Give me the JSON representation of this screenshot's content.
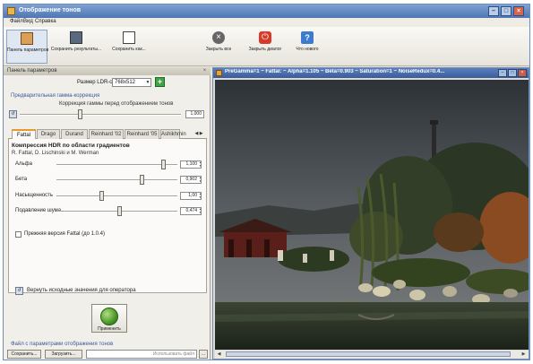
{
  "window": {
    "title": "Отображение тонов"
  },
  "menu": {
    "file": "Файл",
    "view": "Вид",
    "help": "Справка"
  },
  "toolbar": {
    "panel": "Панель параметров",
    "save_processed": "Сохранить результаты...",
    "save_as": "Сохранить как...",
    "close_all": "Закрыть все",
    "close_dialog": "Закрыть диалог",
    "whats_new": "Что нового"
  },
  "params_panel": {
    "title": "Панель параметров",
    "ldr_size_label": "Размер LDR-снимка:",
    "ldr_size_value": "768x512",
    "gamma_section": "Предварительная гамма-коррекция",
    "gamma_label": "Коррекция гаммы перед отображением тонов",
    "gamma_value": "1,000",
    "gamma_level": 0.37
  },
  "tabs": [
    "Fattal",
    "Drago",
    "Durand",
    "Reinhard '02",
    "Reinhard '05",
    "Ashikhmin"
  ],
  "active_tab": 0,
  "operator": {
    "title": "Компрессия HDR по области градиентов",
    "authors": "R. Fattal, D. Lischinski и M. Werman",
    "params": [
      {
        "label": "Альфа",
        "value": "1,100",
        "level": 0.88
      },
      {
        "label": "Бета",
        "value": "0,902",
        "level": 0.7
      },
      {
        "label": "Насыщенность",
        "value": "1,00",
        "level": 0.37
      },
      {
        "label": "Подавление шума",
        "value": "0,474",
        "level": 0.52
      }
    ],
    "old_fattal": "Прежняя версия Fattal (до 1.0.4)",
    "reset": "Вернуть исходные значения для оператора",
    "apply": "Применить"
  },
  "tm_params": {
    "section": "Файл с параметрами отображения тонов",
    "save": "Сохранить...",
    "load": "Загрузить...",
    "file_placeholder": "Использовать файл"
  },
  "image_window": {
    "title": "PreGamma=1 ~ Fattal: ~ Alpha=1.105 ~ Beta=0.903 ~ Saturation=1 ~ NoiseRedux=0.4..."
  }
}
